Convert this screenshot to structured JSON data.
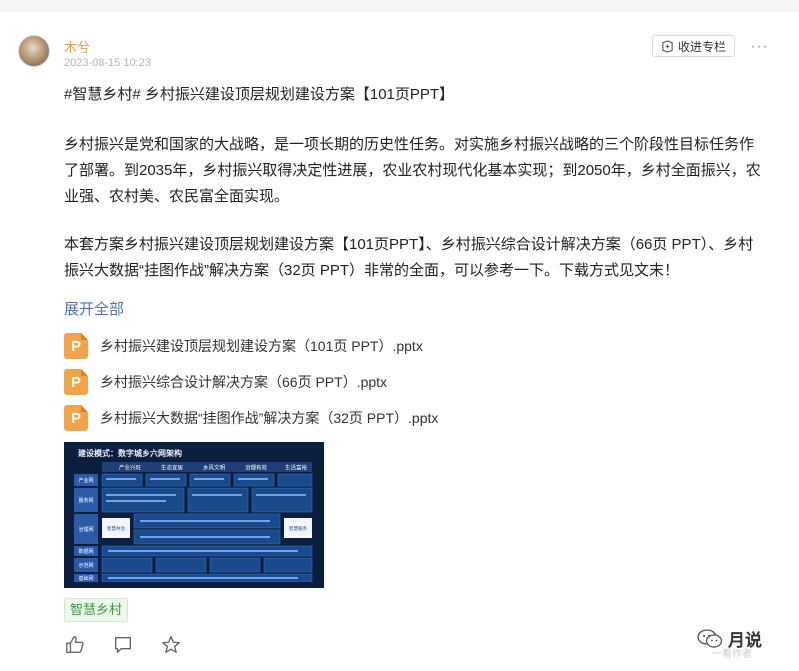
{
  "post": {
    "author": "木兮",
    "time": "2023-08-15 10:23",
    "collect_label": "收进专栏",
    "more": "···",
    "title": "#智慧乡村# 乡村振兴建设顶层规划建设方案【101页PPT】",
    "paragraph1": "乡村振兴是党和国家的大战略，是一项长期的历史性任务。对实施乡村振兴战略的三个阶段性目标任务作了部署。到2035年，乡村振兴取得决定性进展，农业农村现代化基本实现；到2050年，乡村全面振兴，农业强、农村美、农民富全面实现。",
    "paragraph2": "本套方案乡村振兴建设顶层规划建设方案【101页PPT】、乡村振兴综合设计解决方案（66页 PPT）、乡村振兴大数据“挂图作战”解决方案（32页 PPT）非常的全面，可以参考一下。下载方式见文末！",
    "expand_label": "展开全部",
    "files": [
      "乡村振兴建设顶层规划建设方案（101页 PPT）.pptx",
      "乡村振兴综合设计解决方案（66页 PPT）.pptx",
      "乡村振兴大数据“挂图作战”解决方案（32页 PPT）.pptx"
    ],
    "file_icon_letter": "P",
    "thumbnail": {
      "title": "建设模式：数字城乡六网架构",
      "columns": [
        "产业兴旺",
        "生态宜居",
        "乡风文明",
        "治理有效",
        "生活富裕"
      ],
      "rows": [
        "产业网",
        "服务网",
        "治理网",
        "数据网",
        "示范网",
        "基础网"
      ],
      "left_badge": "智慧共治",
      "right_badge": "智慧服务"
    },
    "tag": "智慧乡村",
    "watermark": "月说",
    "watermark_sub": "一看作者"
  },
  "colors": {
    "author": "#e39b3b",
    "link": "#4e74a6",
    "file_icon": "#f2a44a",
    "tag_text": "#3a9a3a",
    "thumb_bg": "#0c1e3e"
  },
  "icons": [
    "collect-icon",
    "more-icon",
    "pptx-file-icon",
    "like-icon",
    "comment-icon",
    "star-icon",
    "wechat-icon"
  ]
}
